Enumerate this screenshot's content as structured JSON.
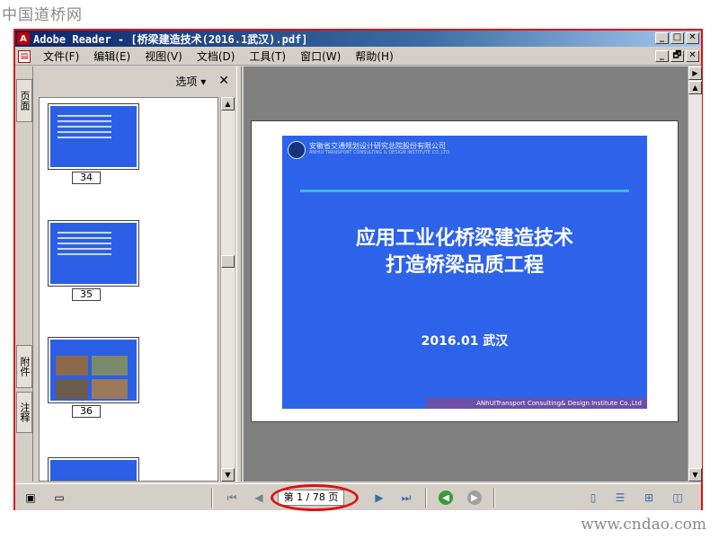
{
  "watermark": {
    "top": "中国道桥网",
    "bottom": "www.cndao.com"
  },
  "window": {
    "title": "Adobe Reader - [桥梁建造技术(2016.1武汉).pdf]",
    "app_icon": "adobe-reader-icon",
    "buttons": [
      "_",
      "□",
      "✕"
    ]
  },
  "menubar": {
    "items": [
      "文件(F)",
      "编辑(E)",
      "视图(V)",
      "文档(D)",
      "工具(T)",
      "窗口(W)",
      "帮助(H)"
    ],
    "doc_buttons": [
      "_",
      "🗗",
      "✕"
    ]
  },
  "nav_tabs": {
    "pages": "页面",
    "attachments": "附件",
    "comments": "注释"
  },
  "thumbnails_panel": {
    "options_label": "选项 ▾",
    "close_label": "✕",
    "thumbs": [
      {
        "page": "34"
      },
      {
        "page": "35"
      },
      {
        "page": "36"
      }
    ]
  },
  "slide": {
    "company": "安徽省交通规划设计研究总院股份有限公司",
    "company_en": "ANHUI TRANSPORT CONSULTING & DESIGN INSTITUTE CO.,LTD.",
    "title_line1": "应用工业化桥梁建造技术",
    "title_line2": "打造桥梁品质工程",
    "date": "2016.01  武汉",
    "footer": "ANhUITransport Consulting& Design Institute Co.,Ltd"
  },
  "statusbar": {
    "page_indicator": "第 1 / 78 页",
    "current_page": 1,
    "total_pages": 78,
    "nav_first": "⏮",
    "nav_prev": "◀",
    "nav_next": "▶",
    "nav_last": "⏭",
    "back": "◀",
    "forward": "▶"
  },
  "colors": {
    "frame_highlight": "#e01010",
    "slide_bg": "#2d62ea",
    "titlebar": "#0a246a"
  }
}
